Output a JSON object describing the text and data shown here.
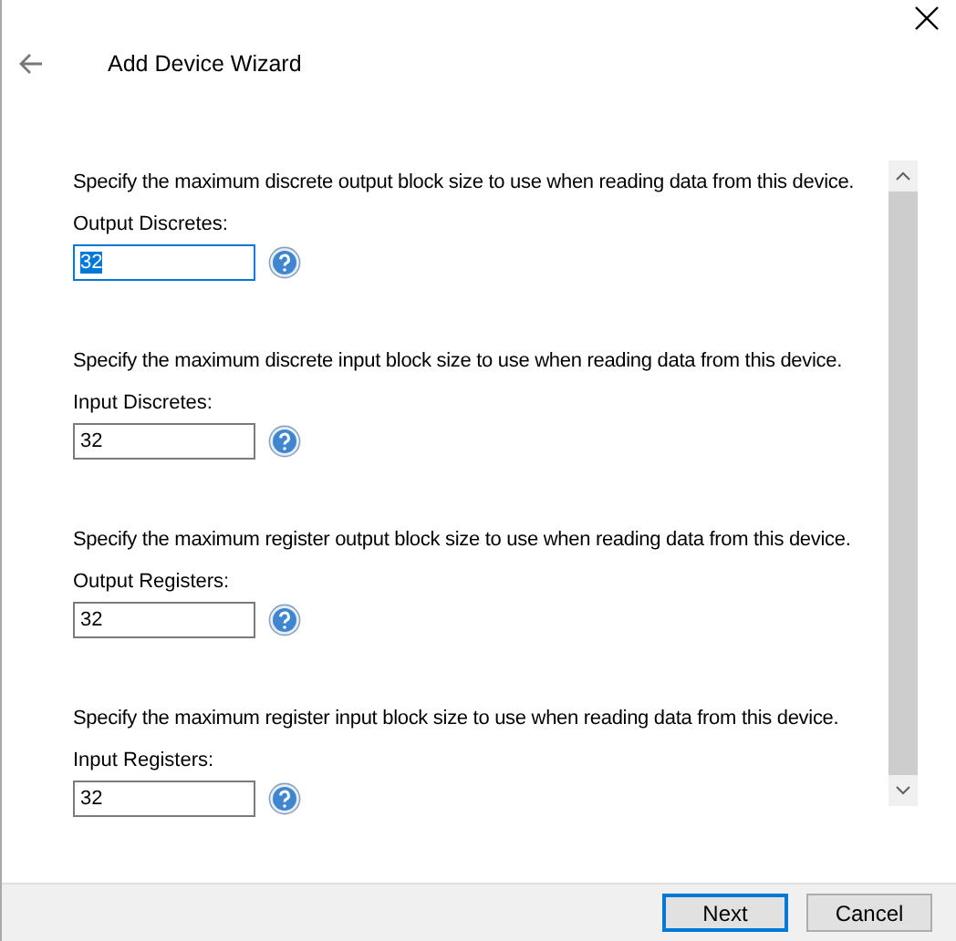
{
  "window": {
    "title": "Add Device Wizard"
  },
  "sections": [
    {
      "description": "Specify the maximum discrete output block size to use when reading data from this device.",
      "label": "Output Discretes:",
      "value": "32",
      "focused": true
    },
    {
      "description": "Specify the maximum discrete input block size to use when reading data from this device.",
      "label": "Input Discretes:",
      "value": "32",
      "focused": false
    },
    {
      "description": "Specify the maximum register output block size to use when reading data from this device.",
      "label": "Output Registers:",
      "value": "32",
      "focused": false
    },
    {
      "description": "Specify the maximum register input block size to use when reading data from this device.",
      "label": "Input Registers:",
      "value": "32",
      "focused": false
    }
  ],
  "buttons": [
    {
      "label": "Next",
      "default": true
    },
    {
      "label": "Cancel",
      "default": false
    }
  ]
}
